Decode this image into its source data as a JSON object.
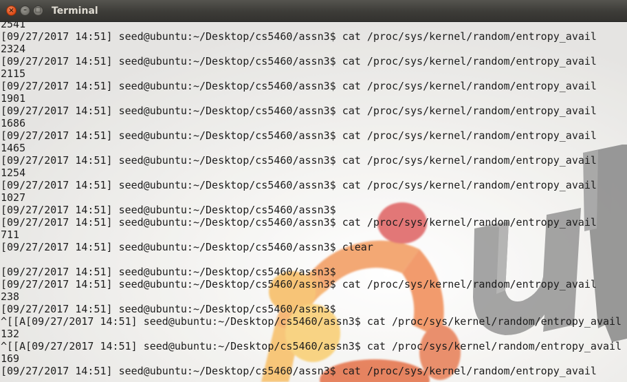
{
  "window": {
    "title": "Terminal",
    "controls": {
      "close": "×",
      "minimize": "–",
      "maximize": "□"
    }
  },
  "terminal": {
    "lines": [
      "2541",
      "[09/27/2017 14:51] seed@ubuntu:~/Desktop/cs5460/assn3$ cat /proc/sys/kernel/random/entropy_avail",
      "2324",
      "[09/27/2017 14:51] seed@ubuntu:~/Desktop/cs5460/assn3$ cat /proc/sys/kernel/random/entropy_avail",
      "2115",
      "[09/27/2017 14:51] seed@ubuntu:~/Desktop/cs5460/assn3$ cat /proc/sys/kernel/random/entropy_avail",
      "1901",
      "[09/27/2017 14:51] seed@ubuntu:~/Desktop/cs5460/assn3$ cat /proc/sys/kernel/random/entropy_avail",
      "1686",
      "[09/27/2017 14:51] seed@ubuntu:~/Desktop/cs5460/assn3$ cat /proc/sys/kernel/random/entropy_avail",
      "1465",
      "[09/27/2017 14:51] seed@ubuntu:~/Desktop/cs5460/assn3$ cat /proc/sys/kernel/random/entropy_avail",
      "1254",
      "[09/27/2017 14:51] seed@ubuntu:~/Desktop/cs5460/assn3$ cat /proc/sys/kernel/random/entropy_avail",
      "1027",
      "[09/27/2017 14:51] seed@ubuntu:~/Desktop/cs5460/assn3$",
      "[09/27/2017 14:51] seed@ubuntu:~/Desktop/cs5460/assn3$ cat /proc/sys/kernel/random/entropy_avail",
      "711",
      "[09/27/2017 14:51] seed@ubuntu:~/Desktop/cs5460/assn3$ clear",
      "",
      "[09/27/2017 14:51] seed@ubuntu:~/Desktop/cs5460/assn3$",
      "[09/27/2017 14:51] seed@ubuntu:~/Desktop/cs5460/assn3$ cat /proc/sys/kernel/random/entropy_avail",
      "238",
      "[09/27/2017 14:51] seed@ubuntu:~/Desktop/cs5460/assn3$",
      "^[[A[09/27/2017 14:51] seed@ubuntu:~/Desktop/cs5460/assn3$ cat /proc/sys/kernel/random/entropy_avail",
      "132",
      "^[[A[09/27/2017 14:51] seed@ubuntu:~/Desktop/cs5460/assn3$ cat /proc/sys/kernel/random/entropy_avail",
      "169",
      "[09/27/2017 14:51] seed@ubuntu:~/Desktop/cs5460/assn3$ cat /proc/sys/kernel/random/entropy_avail"
    ]
  },
  "theme": {
    "title_text_color": "#dfdbd2",
    "close_button_color": "#e1501c",
    "terminal_text_color": "#1c1c1c",
    "terminal_background": "#ecebe8"
  }
}
